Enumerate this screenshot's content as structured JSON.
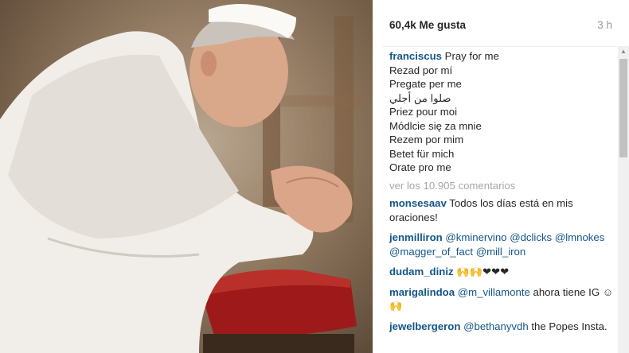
{
  "post": {
    "likes": "60,4k Me gusta",
    "time": "3 h",
    "caption": {
      "user": "franciscus",
      "first_line": "Pray for me",
      "lines": [
        "Rezad por mí",
        "Pregate per me",
        "صلوا من أجلي",
        "Priez pour moi",
        "Módlcie się za mnie",
        "Rezem por mim",
        "Betet für mich",
        "Orate pro me"
      ]
    },
    "view_all": "ver los 10.905 comentarios",
    "comments": [
      {
        "user": "monsesaav",
        "text": "Todos los días está en mis oraciones!"
      },
      {
        "user": "jenmilliron",
        "mentions": [
          "@kminervino",
          "@dclicks",
          "@lmnokes",
          "@magger_of_fact",
          "@mill_iron"
        ]
      },
      {
        "user": "dudam_diniz",
        "text": "🙌🙌❤❤❤"
      },
      {
        "user": "marigalindoa",
        "mention": "@m_villamonte",
        "text": "ahora tiene IG ☺🙌"
      },
      {
        "user": "jewelbergeron",
        "mention": "@bethanyvdh",
        "text": "the Popes Insta."
      }
    ]
  }
}
